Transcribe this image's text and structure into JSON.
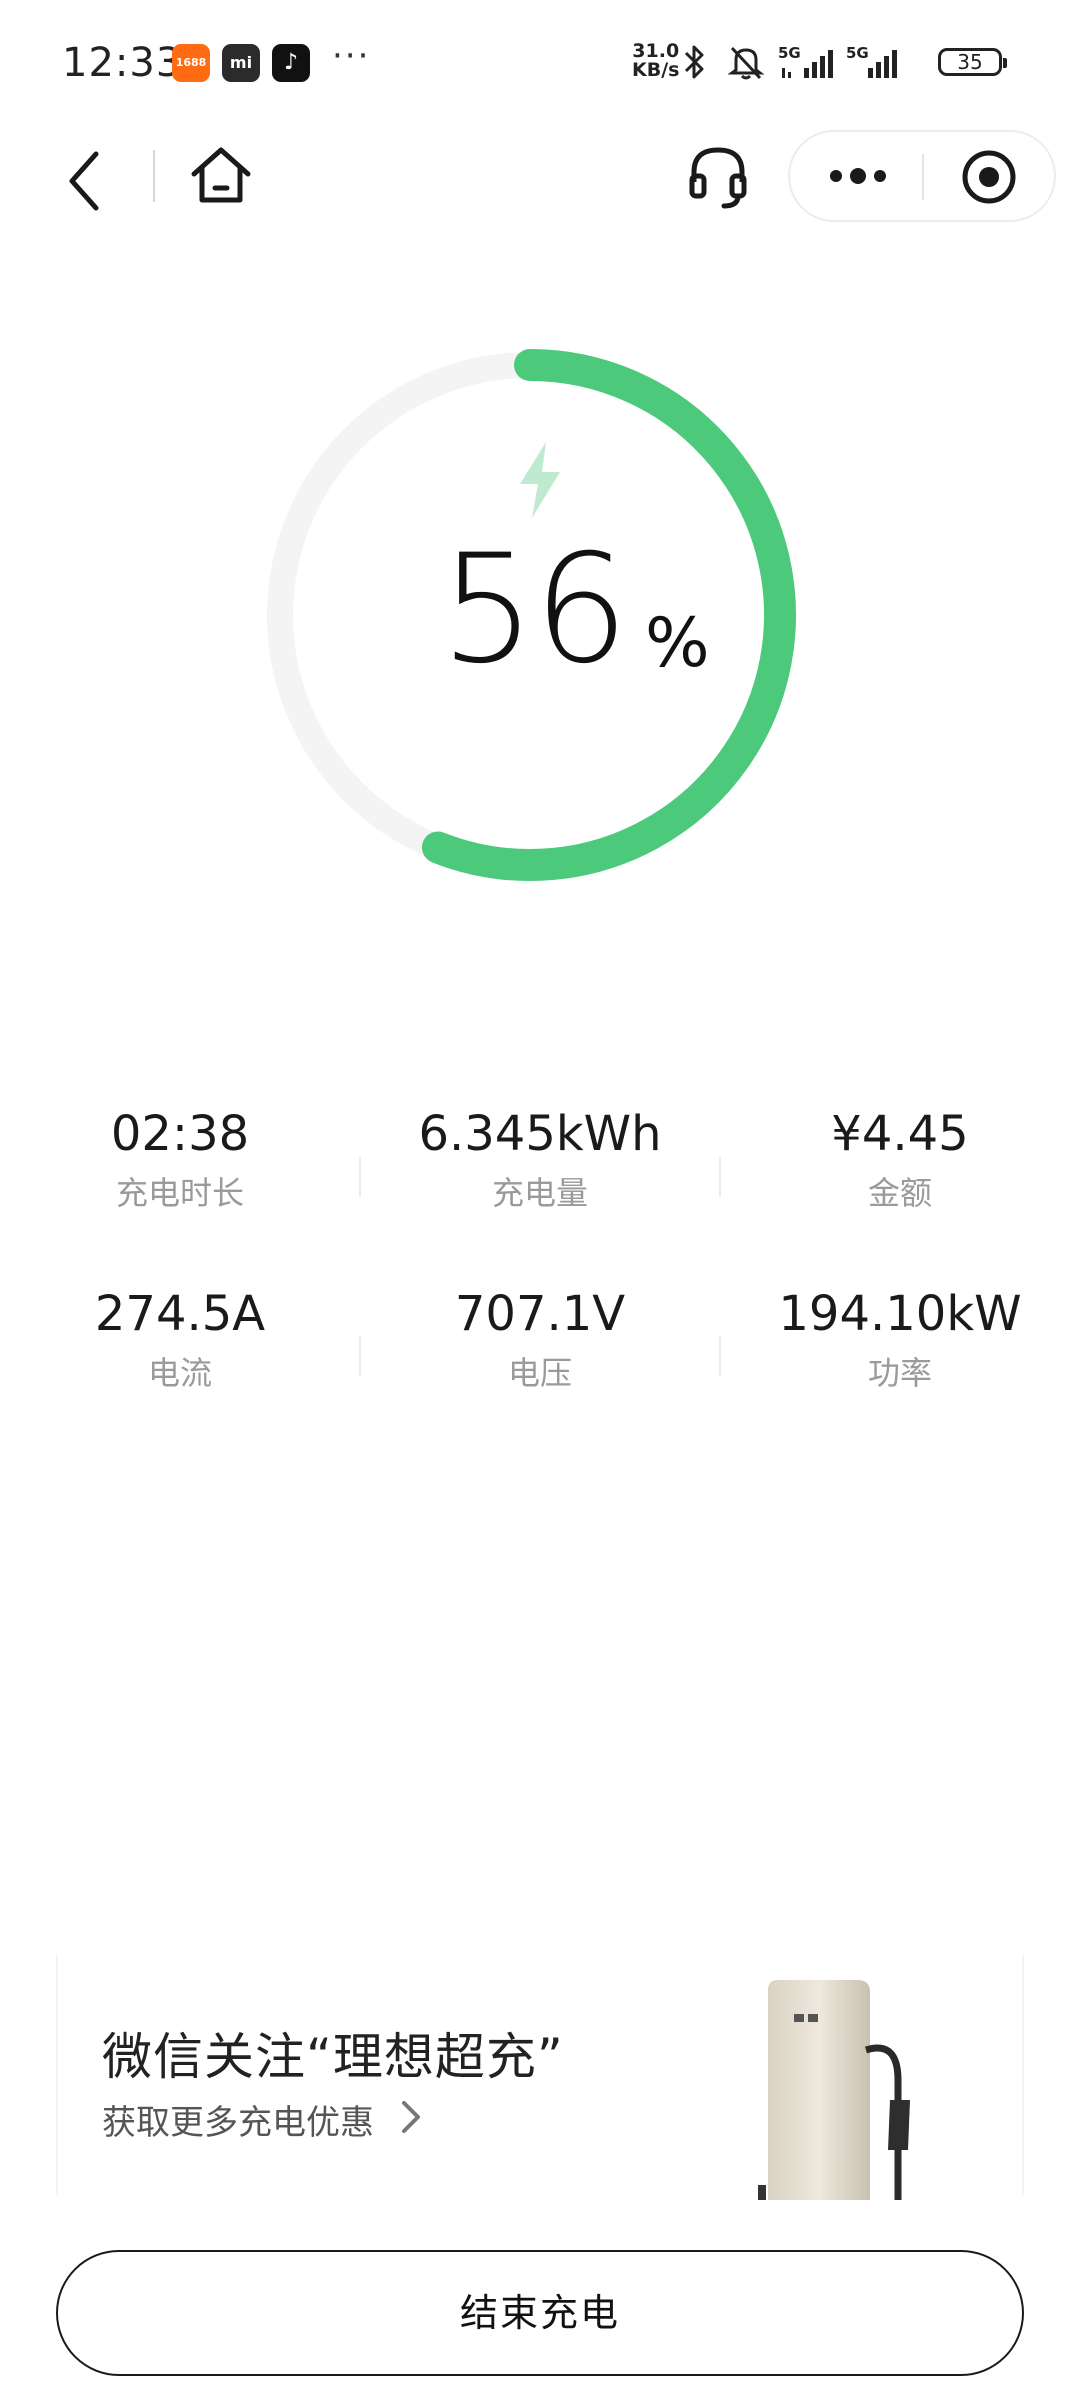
{
  "status_bar": {
    "time": "12:33",
    "apps": [
      "1688-app-icon",
      "mi-app-icon",
      "tiktok-app-icon"
    ],
    "app_labels": [
      "1688",
      "mi",
      "♪"
    ],
    "overflow": "···",
    "net_speed_value": "31.0",
    "net_speed_unit": "KB/s",
    "sim1": "5G",
    "sim2": "5G",
    "battery": "35"
  },
  "nav": {
    "back": "back-icon",
    "home": "home-icon",
    "support": "headset-icon",
    "more": "more-icon",
    "close": "target-icon"
  },
  "charge": {
    "percent_value": "56",
    "percent_sign": "%",
    "percent_fraction": 0.56,
    "accent_color": "#4cc97a",
    "track_color": "#f4f4f4"
  },
  "stats": [
    {
      "value": "02:38",
      "label": "充电时长"
    },
    {
      "value": "6.345kWh",
      "label": "充电量"
    },
    {
      "value": "¥4.45",
      "label": "金额"
    },
    {
      "value": "274.5A",
      "label": "电流"
    },
    {
      "value": "707.1V",
      "label": "电压"
    },
    {
      "value": "194.10kW",
      "label": "功率"
    }
  ],
  "promo": {
    "title": "微信关注“理想超充”",
    "subtitle": "获取更多充电优惠"
  },
  "end_button": {
    "label": "结束充电"
  }
}
